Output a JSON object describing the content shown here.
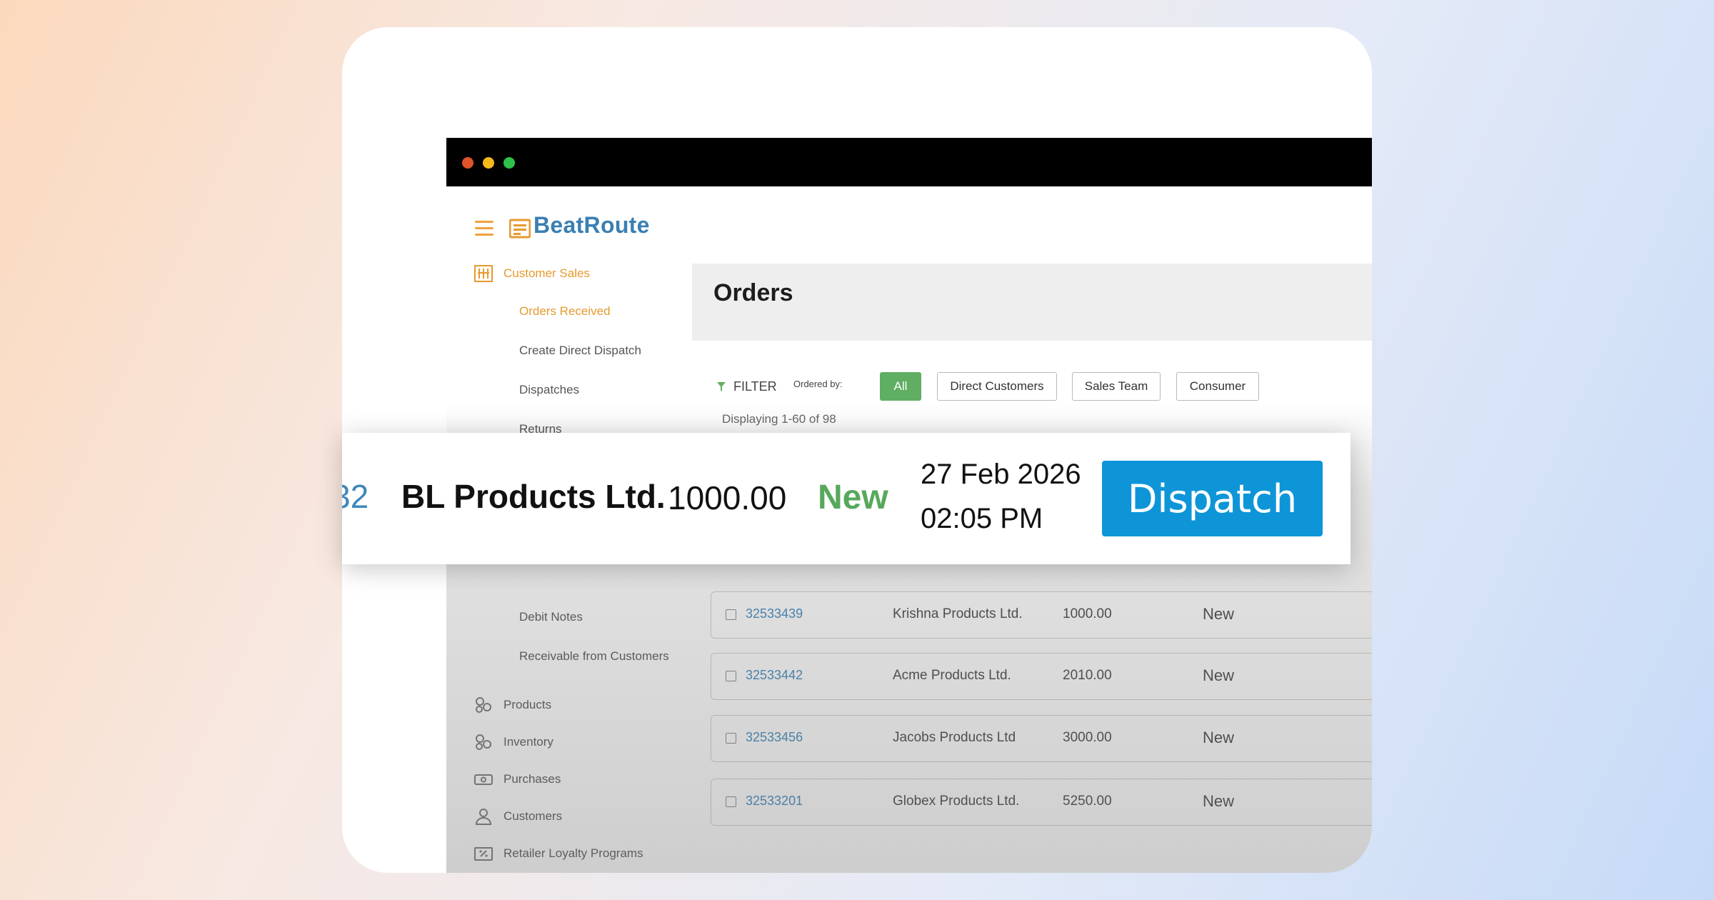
{
  "brand": {
    "name": "BeatRoute",
    "accent": "#e69a2e",
    "logo_color": "#3a7fb3"
  },
  "window": {
    "controls": [
      "close-dot",
      "minimize-dot",
      "maximize-dot"
    ]
  },
  "sidebar": {
    "sections": [
      {
        "label": "Customer Sales",
        "icon": "building-icon",
        "active": true
      },
      {
        "label": "Products",
        "icon": "boxes-icon"
      },
      {
        "label": "Inventory",
        "icon": "boxes-icon"
      },
      {
        "label": "Purchases",
        "icon": "cash-icon"
      },
      {
        "label": "Customers",
        "icon": "user-icon"
      },
      {
        "label": "Retailer Loyalty Programs",
        "icon": "coupon-icon"
      }
    ],
    "sub_items": [
      {
        "label": "Orders Received",
        "active": true
      },
      {
        "label": "Create Direct Dispatch"
      },
      {
        "label": "Dispatches"
      },
      {
        "label": "Returns"
      },
      {
        "label": "Debit Notes"
      },
      {
        "label": "Receivable from Customers"
      }
    ]
  },
  "main": {
    "title": "Orders",
    "filter_label": "FILTER",
    "ordered_by_label": "Ordered by:",
    "filter_chips": [
      {
        "label": "All",
        "selected": true
      },
      {
        "label": "Direct Customers"
      },
      {
        "label": "Sales Team"
      },
      {
        "label": "Consumer"
      }
    ],
    "displaying": "Displaying 1-60 of 98",
    "orders": [
      {
        "id": "32533439",
        "customer": "Krishna Products Ltd.",
        "amount": "1000.00",
        "status": "New"
      },
      {
        "id": "32533442",
        "customer": "Acme Products Ltd.",
        "amount": "2010.00",
        "status": "New"
      },
      {
        "id": "32533456",
        "customer": "Jacobs Products Ltd",
        "amount": "3000.00",
        "status": "New"
      },
      {
        "id": "32533201",
        "customer": "Globex Products Ltd.",
        "amount": "5250.00",
        "status": "New"
      }
    ]
  },
  "highlight_row": {
    "id_fragment": "32",
    "customer": "BL Products Ltd.",
    "amount": "1000.00",
    "status": "New",
    "date": "27 Feb 2026",
    "time": "02:05 PM",
    "action_label": "Dispatch",
    "status_color": "#58a85c",
    "action_color": "#0e95d8"
  }
}
